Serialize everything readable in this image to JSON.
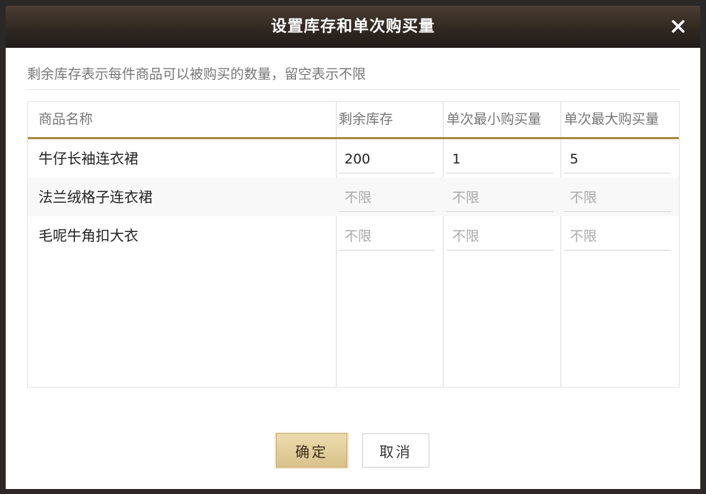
{
  "dialog": {
    "title": "设置库存和单次购买量",
    "hint": "剩余库存表示每件商品可以被购买的数量，留空表示不限"
  },
  "table": {
    "headers": [
      "商品名称",
      "剩余库存",
      "单次最小购买量",
      "单次最大购买量"
    ],
    "rows": [
      {
        "name": "牛仔长袖连衣裙",
        "stock": "200",
        "min": "1",
        "max": "5",
        "stock_placeholder": "",
        "min_placeholder": "",
        "max_placeholder": ""
      },
      {
        "name": "法兰绒格子连衣裙",
        "stock": "",
        "min": "",
        "max": "",
        "stock_placeholder": "不限",
        "min_placeholder": "不限",
        "max_placeholder": "不限"
      },
      {
        "name": "毛呢牛角扣大衣",
        "stock": "",
        "min": "",
        "max": "",
        "stock_placeholder": "不限",
        "min_placeholder": "不限",
        "max_placeholder": "不限"
      }
    ]
  },
  "buttons": {
    "ok": "确定",
    "cancel": "取消"
  },
  "colors": {
    "accent": "#a8893f",
    "ok_button": "#d9c18a"
  },
  "icons": {
    "close": "close-icon"
  }
}
